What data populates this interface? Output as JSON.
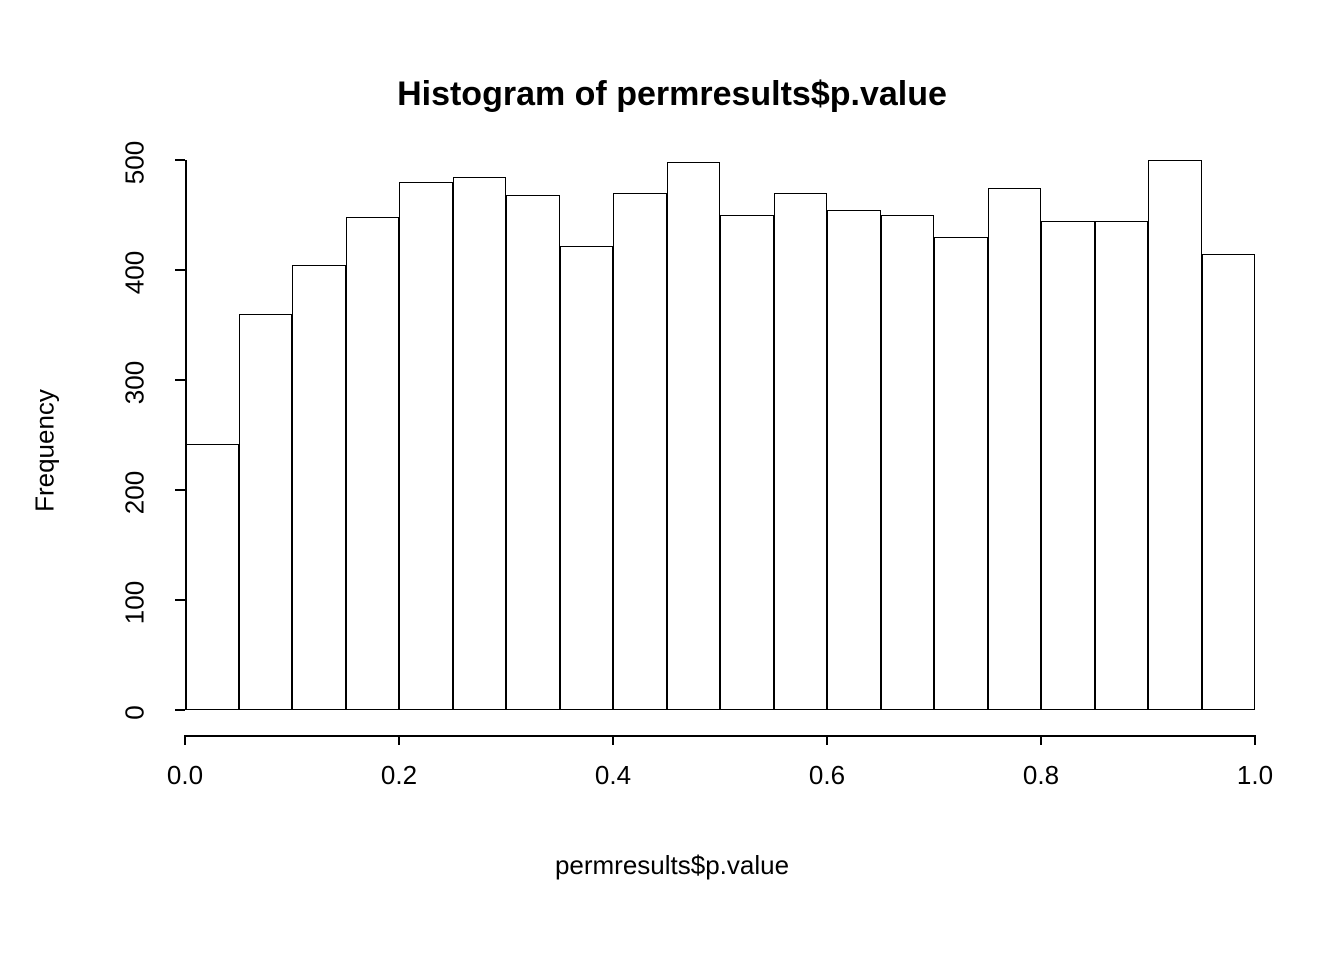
{
  "chart_data": {
    "type": "bar",
    "title": "Histogram of permresults$p.value",
    "xlabel": "permresults$p.value",
    "ylabel": "Frequency",
    "x_breaks": [
      0.0,
      0.05,
      0.1,
      0.15,
      0.2,
      0.25,
      0.3,
      0.35,
      0.4,
      0.45,
      0.5,
      0.55,
      0.6,
      0.65,
      0.7,
      0.75,
      0.8,
      0.85,
      0.9,
      0.95,
      1.0
    ],
    "values": [
      242,
      360,
      405,
      448,
      480,
      485,
      468,
      422,
      470,
      498,
      450,
      470,
      455,
      450,
      430,
      475,
      445,
      445,
      500,
      415
    ],
    "xlim": [
      0.0,
      1.0
    ],
    "ylim": [
      0,
      500
    ],
    "x_ticks": [
      0.0,
      0.2,
      0.4,
      0.6,
      0.8,
      1.0
    ],
    "x_tick_labels": [
      "0.0",
      "0.2",
      "0.4",
      "0.6",
      "0.8",
      "1.0"
    ],
    "y_ticks": [
      0,
      100,
      200,
      300,
      400,
      500
    ],
    "y_tick_labels": [
      "0",
      "100",
      "200",
      "300",
      "400",
      "500"
    ]
  }
}
